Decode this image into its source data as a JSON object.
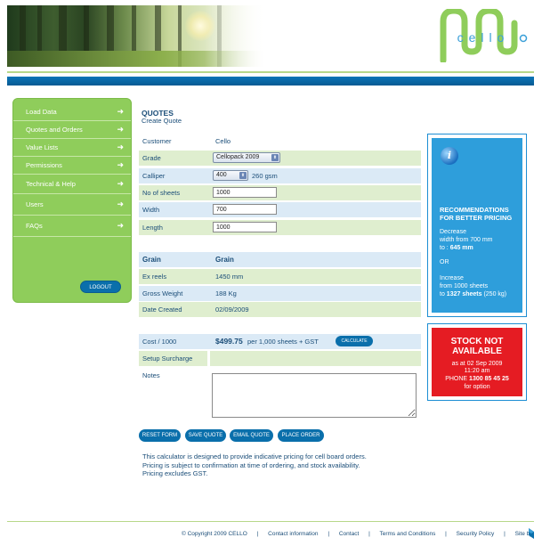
{
  "brand": {
    "logo_text": "cello"
  },
  "sidebar": {
    "items": [
      {
        "label": "Load Data"
      },
      {
        "label": "Quotes and Orders"
      },
      {
        "label": "Value Lists"
      },
      {
        "label": "Permissions"
      },
      {
        "label": "Technical & Help"
      },
      {
        "label": "Users"
      },
      {
        "label": "FAQs"
      }
    ],
    "logout_label": "LOGOUT"
  },
  "page": {
    "title": "QUOTES",
    "subtitle": "Create Quote"
  },
  "form": {
    "customer_label": "Customer",
    "customer_value": "Cello",
    "grade_label": "Grade",
    "grade_value": "Cellopack 2009",
    "calliper_label": "Calliper",
    "calliper_value": "400",
    "calliper_gsm": "260 gsm",
    "sheets_label": "No of sheets",
    "sheets_value": "1000",
    "width_label": "Width",
    "width_value": "700",
    "length_label": "Length",
    "length_value": "1000"
  },
  "grain": {
    "header_left": "Grain",
    "header_right": "Grain",
    "ex_reels_label": "Ex reels",
    "ex_reels_value": "1450 mm",
    "gross_weight_label": "Gross Weight",
    "gross_weight_value": "188 Kg",
    "date_created_label": "Date Created",
    "date_created_value": "02/09/2009"
  },
  "cost": {
    "label": "Cost / 1000",
    "amount": "$499.75",
    "note": "per 1,000 sheets + GST",
    "calculate_label": "CALCULATE",
    "surcharge_label": "Setup Surcharge",
    "notes_label": "Notes"
  },
  "actions": {
    "reset": "RESET FORM",
    "save": "SAVE QUOTE",
    "email": "EMAIL QUOTE",
    "place": "PLACE ORDER"
  },
  "disclaimer": {
    "line1": "This calculator is designed to provide indicative pricing for cell board orders.",
    "line2": "Pricing is subject to confirmation at time of ordering, and stock availability.",
    "line3": "Pricing excludes GST."
  },
  "recommendations": {
    "title_1": "RECOMMENDATIONS",
    "title_2": "FOR BETTER PRICING",
    "decrease_1": "Decrease",
    "decrease_2": "width from 700 mm",
    "decrease_3_pre": "to :",
    "decrease_3_val": "645 mm",
    "or": "OR",
    "increase_1": "Increase",
    "increase_2": "from 1000 sheets",
    "increase_3_pre": "to",
    "increase_3_val": "1327 sheets",
    "increase_3_post": "(250 kg)"
  },
  "stock": {
    "title_1": "STOCK NOT",
    "title_2": "AVAILABLE",
    "as_at": "as at 02 Sep 2009",
    "time": "11:20 am",
    "phone_label": "PHONE",
    "phone_number": "1300 85 45 25",
    "for_option": "for option"
  },
  "footer": {
    "copyright": "© Copyright 2009  CELLO",
    "contact_info": "Contact information",
    "contact": "Contact",
    "terms": "Terms and Conditions",
    "security": "Security Policy",
    "site_by": "Site by",
    "separator": "|"
  },
  "colors": {
    "brand_blue": "#0a6fab",
    "sidebar_green": "#8fcd5b",
    "row_green": "#dfeecf",
    "row_blue": "#dbeaf6",
    "reco_blue": "#2e9edb",
    "stock_red": "#e51c23"
  }
}
